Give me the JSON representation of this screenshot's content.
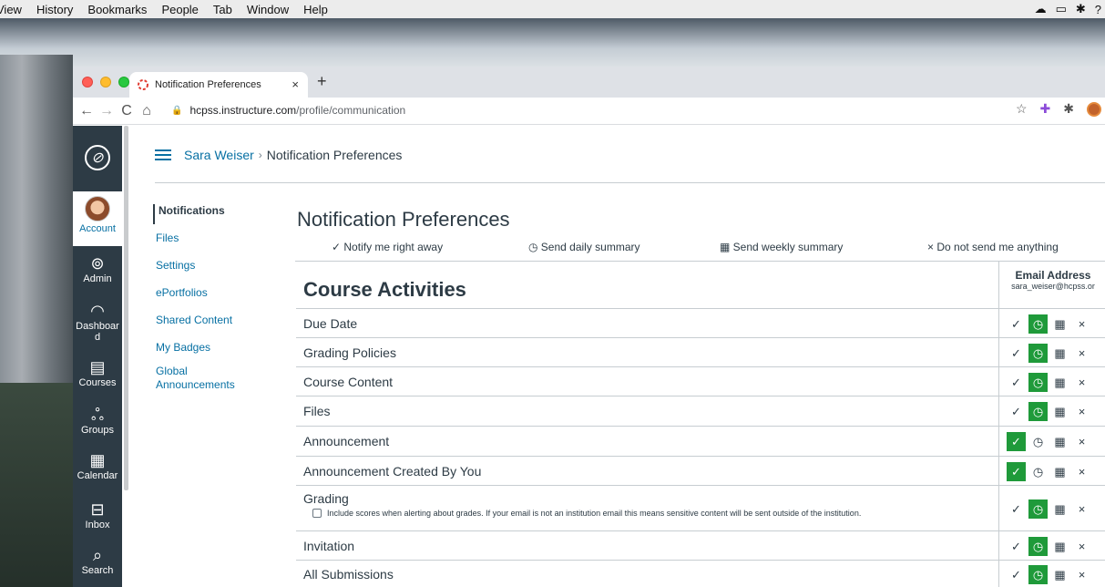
{
  "menubar": {
    "items": [
      "View",
      "History",
      "Bookmarks",
      "People",
      "Tab",
      "Window",
      "Help"
    ],
    "right_icons": [
      "cloud-icon",
      "airplay-icon",
      "bluetooth-icon",
      "help-icon"
    ]
  },
  "browser": {
    "tab": {
      "title": "Notification Preferences",
      "close_glyph": "×"
    },
    "newtab_glyph": "+",
    "url_host": "hcpss.instructure.com",
    "url_path": "/profile/communication",
    "nav_glyphs": {
      "back": "←",
      "forward": "→",
      "reload": "C",
      "home": "⌂"
    },
    "toolbar_icons": [
      "star-icon",
      "extension-icon",
      "puzzle-icon",
      "profile-icon"
    ]
  },
  "globalnav": {
    "logo_glyph": "⊘",
    "items": [
      {
        "label": "Account",
        "icon": "avatar"
      },
      {
        "label": "Admin",
        "icon": "shield-icon",
        "glyph": "⊚"
      },
      {
        "label": "Dashboard",
        "line1": "Dashboar",
        "line2": "d",
        "icon": "dashboard-icon",
        "glyph": "◠"
      },
      {
        "label": "Courses",
        "icon": "book-icon",
        "glyph": "▤"
      },
      {
        "label": "Groups",
        "icon": "groups-icon",
        "glyph": "ஃ"
      },
      {
        "label": "Calendar",
        "icon": "calendar-icon",
        "glyph": "▦"
      },
      {
        "label": "Inbox",
        "icon": "inbox-icon",
        "glyph": "⊟"
      },
      {
        "label": "Search",
        "icon": "search-icon",
        "glyph": "⌕"
      }
    ]
  },
  "breadcrumb": {
    "user": "Sara Weiser",
    "separator": "›",
    "page": "Notification Preferences"
  },
  "leftnav": {
    "current": "Notifications",
    "links": [
      "Files",
      "Settings",
      "ePortfolios",
      "Shared Content",
      "My Badges",
      "Global",
      "Announcements"
    ]
  },
  "main": {
    "title": "Notification Preferences",
    "legend": {
      "right_away": "✓ Notify me right away",
      "daily": "◷ Send daily summary",
      "weekly": "▦ Send weekly summary",
      "never": "× Do not send me anything"
    },
    "section_title": "Course Activities",
    "email_header": "Email Address",
    "email_value": "sara_weiser@hcpss.or",
    "option_glyphs": [
      "✓",
      "◷",
      "▦",
      "×"
    ],
    "rows": [
      {
        "label": "Due Date",
        "selected": 1
      },
      {
        "label": "Grading Policies",
        "selected": 1
      },
      {
        "label": "Course Content",
        "selected": 1
      },
      {
        "label": "Files",
        "selected": 1
      },
      {
        "label": "Announcement",
        "selected": 0
      },
      {
        "label": "Announcement Created By You",
        "selected": 0
      },
      {
        "label": "Grading",
        "selected": 1,
        "note": "Include scores when alerting about grades. If your email is not an institution email this means sensitive content will be sent outside of the institution."
      },
      {
        "label": "Invitation",
        "selected": 1
      },
      {
        "label": "All Submissions",
        "selected": 1
      }
    ]
  },
  "colors": {
    "nav_bg": "#2d3b45",
    "link": "#0770a3",
    "selected_green": "#1f9a3a"
  }
}
